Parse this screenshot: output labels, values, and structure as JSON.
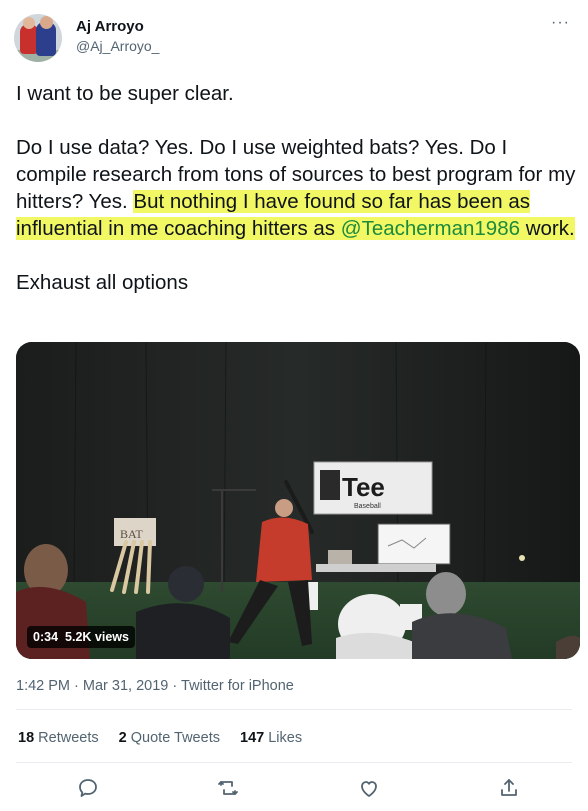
{
  "author": {
    "name": "Aj Arroyo",
    "handle": "@Aj_Arroyo_"
  },
  "more_glyph": "···",
  "tweet": {
    "line1": "I want to be super clear.",
    "para2_plain": "Do I use data? Yes. Do I use weighted bats? Yes. Do I compile research from tons of sources to best program for my hitters? Yes.",
    "para2_highlight": "But nothing I have found so far has been as influential in me coaching hitters as",
    "mention": "@Teacherman1986",
    "para2_end": "work.",
    "line3": "Exhaust all options"
  },
  "video": {
    "duration": "0:34",
    "views": "5.2K views",
    "sign_text": "Tee",
    "sign_sub": "Baseball",
    "bat_sign": "BAT"
  },
  "meta": {
    "time": "1:42 PM",
    "separator": "·",
    "date": "Mar 31, 2019",
    "source": "Twitter for iPhone"
  },
  "stats": {
    "retweets_count": "18",
    "retweets_label": "Retweets",
    "quotes_count": "2",
    "quotes_label": "Quote Tweets",
    "likes_count": "147",
    "likes_label": "Likes"
  },
  "colors": {
    "highlight": "#f1f864",
    "mention": "#1b8a3c",
    "secondary_text": "#536471"
  },
  "actions": [
    "reply-icon",
    "retweet-icon",
    "like-icon",
    "share-icon"
  ]
}
